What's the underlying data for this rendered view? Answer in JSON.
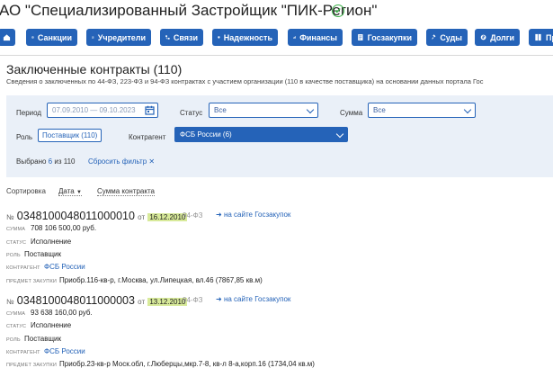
{
  "company": {
    "title": "АО \"Специализированный Застройщик \"ПИК-Регион\""
  },
  "nav": [
    {
      "label": "",
      "icon": "home-icon"
    },
    {
      "label": "Санкции",
      "icon": "globe-icon"
    },
    {
      "label": "Учредители",
      "icon": "users-icon"
    },
    {
      "label": "Связи",
      "icon": "network-icon"
    },
    {
      "label": "Надежность",
      "icon": "shield-icon"
    },
    {
      "label": "Финансы",
      "icon": "chart-icon"
    },
    {
      "label": "Госзакупки",
      "icon": "document-icon"
    },
    {
      "label": "Суды",
      "icon": "gavel-icon"
    },
    {
      "label": "Долги",
      "icon": "money-icon"
    },
    {
      "label": "Пр",
      "icon": "book-icon"
    }
  ],
  "section": {
    "title": "Заключенные контракты (110)",
    "subtitle": "Сведения о заключенных по 44-ФЗ, 223-ФЗ и 94-ФЗ контрактах с участием организации (110 в качестве поставщика) на основании данных портала Гос"
  },
  "filters": {
    "period_label": "Период",
    "period_value": "07.09.2010 — 09.10.2023",
    "status_label": "Статус",
    "status_value": "Все",
    "sum_label": "Сумма",
    "sum_value": "Все",
    "role_label": "Роль",
    "role_value": "Поставщик (110)",
    "contragent_label": "Контрагент",
    "contragent_value": "ФСБ России (6)",
    "selected_prefix": "Выбрано",
    "selected_count": "6",
    "selected_suffix": "из 110",
    "reset_label": "Сбросить фильтр ✕"
  },
  "sort": {
    "label": "Сортировка",
    "by_date": "Дата",
    "by_sum": "Сумма контракта"
  },
  "labels": {
    "no": "№",
    "from": "от",
    "sum": "сумма",
    "status": "статус",
    "role": "роль",
    "contragent": "контрагент",
    "subject": "предмет закупки",
    "goszakupki_link": "на сайте Госзакупок"
  },
  "contracts": [
    {
      "number": "0348100048011000010",
      "date": "16.12.2010",
      "law": "94-ФЗ",
      "sum": "708 106 500,00 руб.",
      "status": "Исполнение",
      "role": "Поставщик",
      "contragent": "ФСБ России",
      "subject": "Приобр.116-кв-р, г.Москва, ул.Липецкая, вл.46 (7867,85 кв.м)"
    },
    {
      "number": "0348100048011000003",
      "date": "13.12.2010",
      "law": "94-ФЗ",
      "sum": "93 638 160,00 руб.",
      "status": "Исполнение",
      "role": "Поставщик",
      "contragent": "ФСБ России",
      "subject": "Приобр.23-кв-р Моск.обл, г.Люберцы,мкр.7-8, кв-л 8-а,корп.16 (1734,04 кв.м)"
    }
  ],
  "colors": {
    "accent": "#2563b8",
    "highlight": "#d8ea9a",
    "verified": "#3db34a",
    "panel": "#eaf0f8"
  }
}
